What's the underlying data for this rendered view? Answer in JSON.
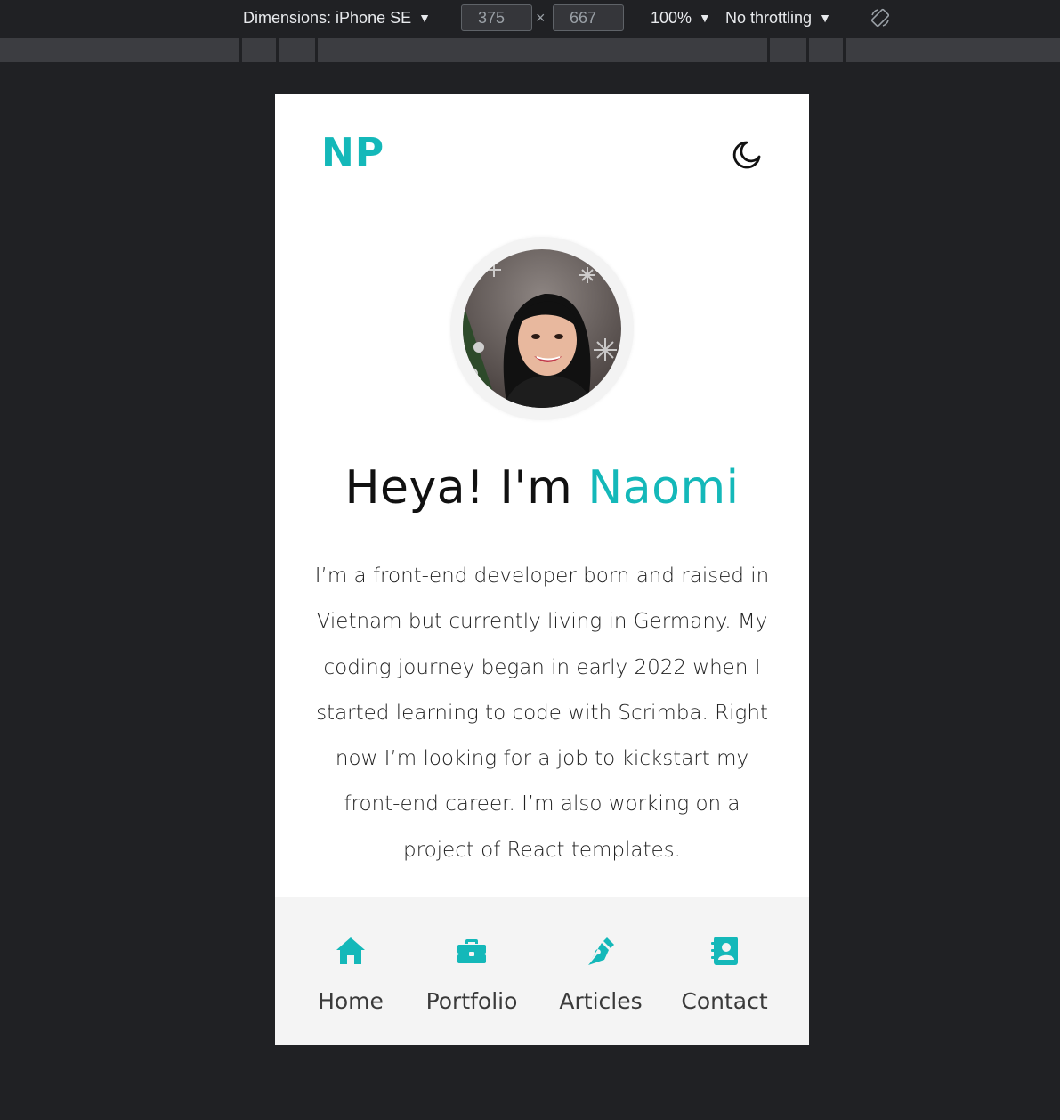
{
  "devtools": {
    "dimensions_label": "Dimensions: iPhone SE",
    "width_value": "375",
    "times": "×",
    "height_value": "667",
    "zoom": "100%",
    "throttling": "No throttling",
    "caret": "▼"
  },
  "site": {
    "logo": "NP",
    "theme_icon": "moon-icon",
    "heading_prefix": "Heya! I'm",
    "heading_name": "Naomi",
    "bio": "I’m a front-end developer born and raised in Vietnam but currently living in Germany. My coding journey began in early 2022 when I started learning to code with Scrimba. Right now I’m looking for a job to kickstart my front-end career. I’m also working on a project of React templates.",
    "accent_color": "#14b8b9"
  },
  "nav": {
    "items": [
      {
        "label": "Home",
        "icon": "home-icon"
      },
      {
        "label": "Portfolio",
        "icon": "briefcase-icon"
      },
      {
        "label": "Articles",
        "icon": "pen-nib-icon"
      },
      {
        "label": "Contact",
        "icon": "address-book-icon"
      }
    ]
  }
}
